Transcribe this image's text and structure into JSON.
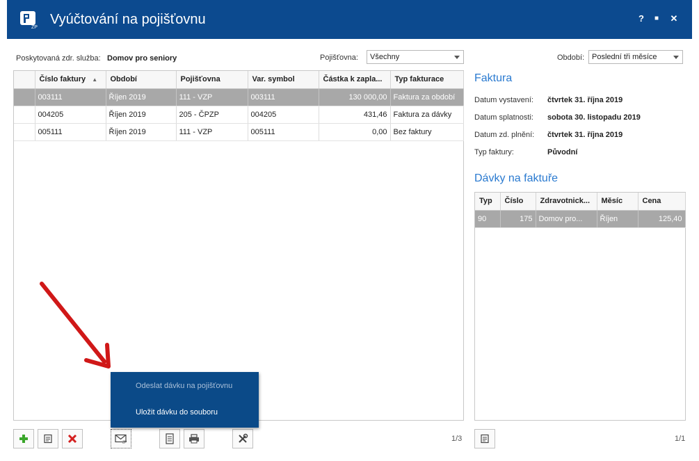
{
  "window": {
    "title": "Vyúčtování na pojišťovnu",
    "help_label": "?",
    "maximize_label": "■",
    "close_label": "✕"
  },
  "filters": {
    "service_label": "Poskytovaná zdr. služba:",
    "service_value": "Domov pro seniory",
    "insurer_label": "Pojišťovna:",
    "insurer_value": "Všechny",
    "period_label": "Období:",
    "period_value": "Poslední tři měsíce"
  },
  "invoices": {
    "columns": [
      "Číslo faktury",
      "Období",
      "Pojišťovna",
      "Var. symbol",
      "Částka k zapla...",
      "Typ fakturace"
    ],
    "rows": [
      [
        "003111",
        "Říjen 2019",
        "111 - VZP",
        "003111",
        "130 000,00",
        "Faktura za období"
      ],
      [
        "004205",
        "Říjen 2019",
        "205 - ČPZP",
        "004205",
        "431,46",
        "Faktura za dávky"
      ],
      [
        "005111",
        "Říjen 2019",
        "111 - VZP",
        "005111",
        "0,00",
        "Bez faktury"
      ]
    ],
    "selected_row": 0,
    "sort_indicator": "▲",
    "pager": "1/3"
  },
  "detail": {
    "title": "Faktura",
    "issued_label": "Datum vystavení:",
    "issued_value": "čtvrtek 31. října 2019",
    "due_label": "Datum splatnosti:",
    "due_value": "sobota 30. listopadu 2019",
    "supply_label": "Datum zd. plnění:",
    "supply_value": "čtvrtek 31. října 2019",
    "type_label": "Typ faktury:",
    "type_value": "Původní"
  },
  "batches": {
    "title": "Dávky na faktuře",
    "columns": [
      "Typ",
      "Číslo",
      "Zdravotnick...",
      "Měsíc",
      "Cena"
    ],
    "rows": [
      [
        "90",
        "175",
        "Domov pro...",
        "Říjen",
        "125,40"
      ]
    ],
    "pager": "1/1"
  },
  "popup": {
    "send_label": "Odeslat dávku na pojišťovnu",
    "save_label": "Uložit dávku do souboru"
  },
  "colors": {
    "titlebar": "#0c4a8f",
    "accent": "#2a7ad0",
    "add_green": "#3aa62a",
    "delete_red": "#d42020",
    "arrow_red": "#d01818"
  },
  "icons": {
    "logo": "zp-logo-icon",
    "add": "plus-icon",
    "edit": "document-edit-icon",
    "delete": "x-icon",
    "send": "envelope-zp-icon",
    "report": "document-icon",
    "print": "printer-icon",
    "tools": "tools-icon"
  }
}
